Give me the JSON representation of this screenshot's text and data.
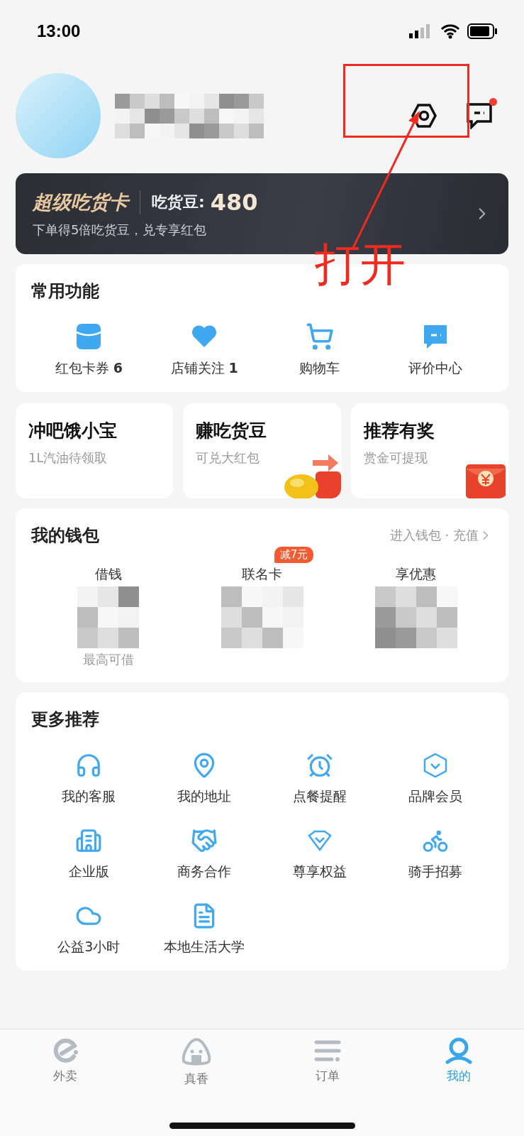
{
  "status_bar": {
    "time": "13:00"
  },
  "header": {
    "message_badge": true
  },
  "annotation": {
    "label": "打开"
  },
  "vip_card": {
    "title": "超级吃货卡",
    "points_label": "吃货豆:",
    "points": "480",
    "subtitle": "下单得5倍吃货豆，兑专享红包"
  },
  "common_functions": {
    "title": "常用功能",
    "items": [
      {
        "label": "红包卡券",
        "count": "6"
      },
      {
        "label": "店铺关注",
        "count": "1"
      },
      {
        "label": "购物车"
      },
      {
        "label": "评价中心"
      }
    ]
  },
  "promo_cards": [
    {
      "title": "冲吧饿小宝",
      "subtitle": "1L汽油待领取"
    },
    {
      "title": "赚吃货豆",
      "subtitle": "可兑大红包"
    },
    {
      "title": "推荐有奖",
      "subtitle": "赏金可提现"
    }
  ],
  "wallet": {
    "title": "我的钱包",
    "link": "进入钱包 · 充值",
    "items": [
      {
        "label": "借钱",
        "sublabel": "最高可借"
      },
      {
        "label": "联名卡",
        "badge": "减7元"
      },
      {
        "label": "享优惠"
      }
    ]
  },
  "more": {
    "title": "更多推荐",
    "items": [
      {
        "label": "我的客服"
      },
      {
        "label": "我的地址"
      },
      {
        "label": "点餐提醒"
      },
      {
        "label": "品牌会员"
      },
      {
        "label": "企业版"
      },
      {
        "label": "商务合作"
      },
      {
        "label": "尊享权益"
      },
      {
        "label": "骑手招募"
      },
      {
        "label": "公益3小时"
      },
      {
        "label": "本地生活大学"
      }
    ]
  },
  "tab_bar": [
    {
      "label": "外卖",
      "selected": false
    },
    {
      "label": "真香",
      "selected": false
    },
    {
      "label": "订单",
      "selected": false
    },
    {
      "label": "我的",
      "selected": true
    }
  ]
}
